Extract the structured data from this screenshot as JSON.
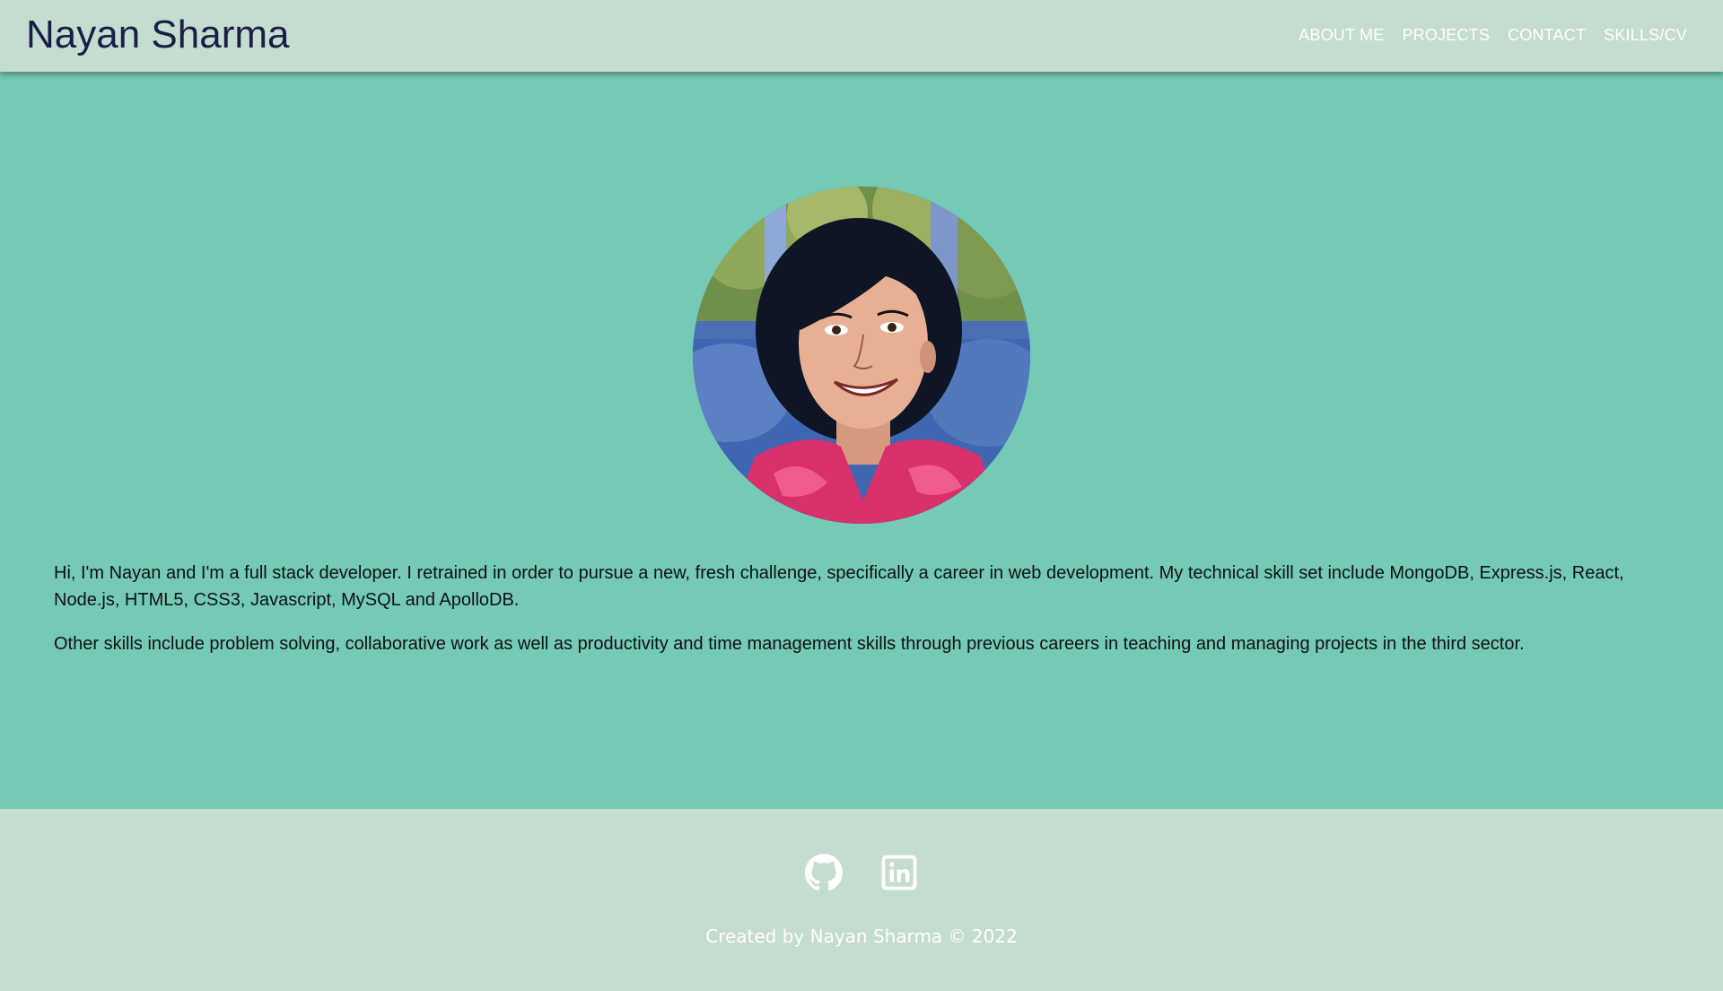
{
  "header": {
    "title": "Nayan Sharma",
    "nav": [
      {
        "label": "ABOUT ME"
      },
      {
        "label": "PROJECTS"
      },
      {
        "label": "CONTACT"
      },
      {
        "label": "SKILLS/CV"
      }
    ]
  },
  "main": {
    "avatar_alt": "portrait",
    "bio": [
      "Hi, I'm Nayan and I'm a full stack developer. I retrained in order to pursue a new, fresh challenge, specifically a career in web development. My technical skill set include MongoDB, Express.js, React, Node.js, HTML5, CSS3, Javascript, MySQL and ApolloDB.",
      "Other skills include problem solving, collaborative work as well as productivity and time management skills through previous careers in teaching and managing projects in the third sector."
    ]
  },
  "footer": {
    "social": [
      {
        "icon": "github-icon"
      },
      {
        "icon": "linkedin-icon"
      }
    ],
    "credit": "Created by Nayan Sharma © 2022"
  },
  "colors": {
    "header_bg": "#c5ddce",
    "main_bg": "#74cab6",
    "title": "#1a1f4a",
    "nav_text": "#ffffff"
  }
}
